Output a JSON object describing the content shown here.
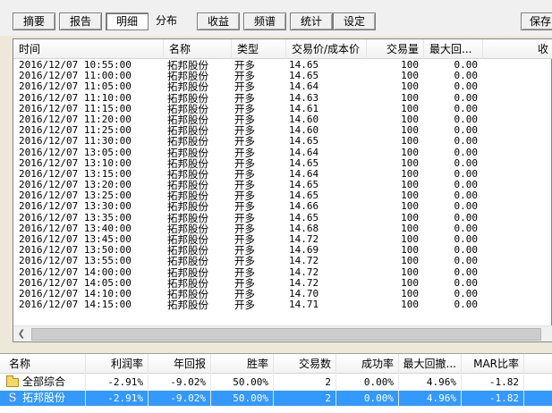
{
  "tabs": [
    {
      "label": "摘要",
      "active": false
    },
    {
      "label": "报告",
      "active": false
    },
    {
      "label": "明细",
      "active": true
    },
    {
      "label": "分布",
      "active": false
    },
    {
      "label": "收益",
      "active": false
    },
    {
      "label": "频谱",
      "active": false
    },
    {
      "label": "统计",
      "active": false
    },
    {
      "label": "设定",
      "active": false
    }
  ],
  "save_label": "保存",
  "detail": {
    "columns": [
      "时间",
      "名称",
      "类型",
      "交易价/成本价",
      "交易量",
      "最大回...",
      "收"
    ],
    "rows": [
      [
        "2016/12/07 10:55:00",
        "拓邦股份",
        "开多",
        "14.65",
        "100",
        "0.00"
      ],
      [
        "2016/12/07 11:00:00",
        "拓邦股份",
        "开多",
        "14.65",
        "100",
        "0.00"
      ],
      [
        "2016/12/07 11:05:00",
        "拓邦股份",
        "开多",
        "14.64",
        "100",
        "0.00"
      ],
      [
        "2016/12/07 11:10:00",
        "拓邦股份",
        "开多",
        "14.63",
        "100",
        "0.00"
      ],
      [
        "2016/12/07 11:15:00",
        "拓邦股份",
        "开多",
        "14.61",
        "100",
        "0.00"
      ],
      [
        "2016/12/07 11:20:00",
        "拓邦股份",
        "开多",
        "14.60",
        "100",
        "0.00"
      ],
      [
        "2016/12/07 11:25:00",
        "拓邦股份",
        "开多",
        "14.60",
        "100",
        "0.00"
      ],
      [
        "2016/12/07 11:30:00",
        "拓邦股份",
        "开多",
        "14.65",
        "100",
        "0.00"
      ],
      [
        "2016/12/07 13:05:00",
        "拓邦股份",
        "开多",
        "14.64",
        "100",
        "0.00"
      ],
      [
        "2016/12/07 13:10:00",
        "拓邦股份",
        "开多",
        "14.65",
        "100",
        "0.00"
      ],
      [
        "2016/12/07 13:15:00",
        "拓邦股份",
        "开多",
        "14.64",
        "100",
        "0.00"
      ],
      [
        "2016/12/07 13:20:00",
        "拓邦股份",
        "开多",
        "14.65",
        "100",
        "0.00"
      ],
      [
        "2016/12/07 13:25:00",
        "拓邦股份",
        "开多",
        "14.65",
        "100",
        "0.00"
      ],
      [
        "2016/12/07 13:30:00",
        "拓邦股份",
        "开多",
        "14.66",
        "100",
        "0.00"
      ],
      [
        "2016/12/07 13:35:00",
        "拓邦股份",
        "开多",
        "14.65",
        "100",
        "0.00"
      ],
      [
        "2016/12/07 13:40:00",
        "拓邦股份",
        "开多",
        "14.68",
        "100",
        "0.00"
      ],
      [
        "2016/12/07 13:45:00",
        "拓邦股份",
        "开多",
        "14.72",
        "100",
        "0.00"
      ],
      [
        "2016/12/07 13:50:00",
        "拓邦股份",
        "开多",
        "14.69",
        "100",
        "0.00"
      ],
      [
        "2016/12/07 13:55:00",
        "拓邦股份",
        "开多",
        "14.72",
        "100",
        "0.00"
      ],
      [
        "2016/12/07 14:00:00",
        "拓邦股份",
        "开多",
        "14.72",
        "100",
        "0.00"
      ],
      [
        "2016/12/07 14:05:00",
        "拓邦股份",
        "开多",
        "14.72",
        "100",
        "0.00"
      ],
      [
        "2016/12/07 14:10:00",
        "拓邦股份",
        "开多",
        "14.70",
        "100",
        "0.00"
      ],
      [
        "2016/12/07 14:15:00",
        "拓邦股份",
        "开多",
        "14.71",
        "100",
        "0.00"
      ]
    ]
  },
  "summary": {
    "columns": [
      "名称",
      "利润率",
      "年回报",
      "胜率",
      "交易数",
      "成功率",
      "最大回撤...",
      "MAR比率"
    ],
    "rows": [
      {
        "icon": "folder-icon",
        "values": [
          "全部综合",
          "-2.91%",
          "-9.02%",
          "50.00%",
          "2",
          "0.00%",
          "4.96%",
          "-1.82"
        ],
        "selected": false
      },
      {
        "icon": "s-icon",
        "icon_glyph": "S",
        "values": [
          "拓邦股份",
          "-2.91%",
          "-9.02%",
          "50.00%",
          "2",
          "0.00%",
          "4.96%",
          "-1.82"
        ],
        "selected": true
      }
    ]
  },
  "colors": {
    "selection": "#3399ff",
    "background": "#f0f0f0"
  }
}
